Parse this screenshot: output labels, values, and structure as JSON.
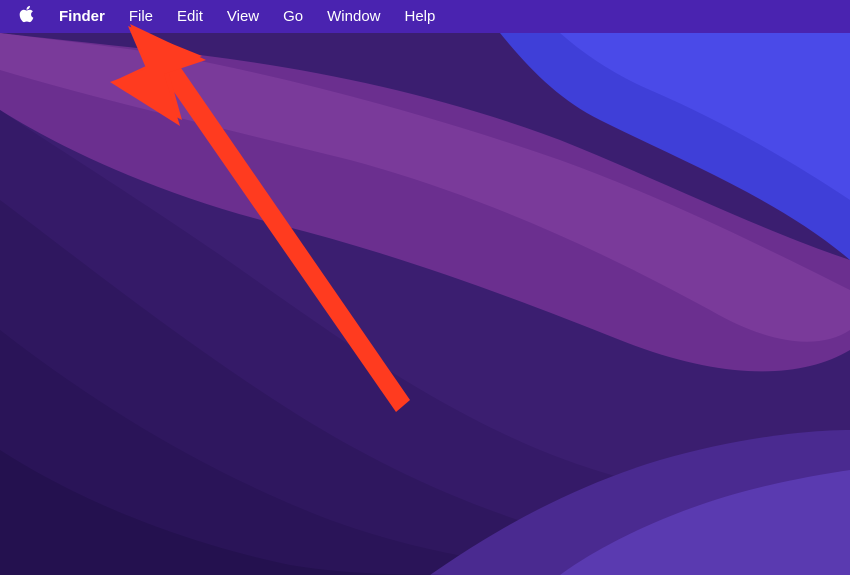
{
  "menubar": {
    "app_name": "Finder",
    "items": [
      {
        "label": "File"
      },
      {
        "label": "Edit"
      },
      {
        "label": "View"
      },
      {
        "label": "Go"
      },
      {
        "label": "Window"
      },
      {
        "label": "Help"
      }
    ]
  },
  "colors": {
    "menubar_bg": "#4a23b0",
    "arrow": "#ff3b1f"
  }
}
